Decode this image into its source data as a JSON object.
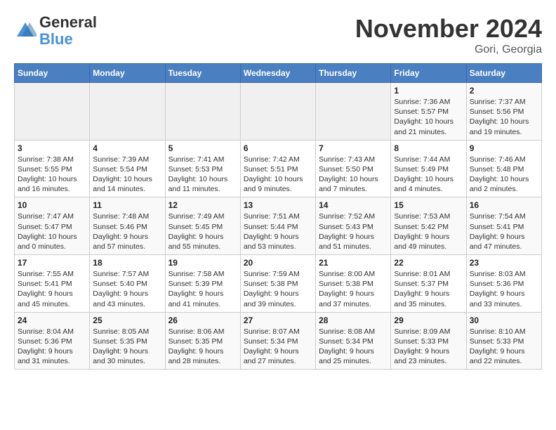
{
  "logo": {
    "general": "General",
    "blue": "Blue"
  },
  "title": "November 2024",
  "location": "Gori, Georgia",
  "days_of_week": [
    "Sunday",
    "Monday",
    "Tuesday",
    "Wednesday",
    "Thursday",
    "Friday",
    "Saturday"
  ],
  "weeks": [
    [
      {
        "day": "",
        "info": ""
      },
      {
        "day": "",
        "info": ""
      },
      {
        "day": "",
        "info": ""
      },
      {
        "day": "",
        "info": ""
      },
      {
        "day": "",
        "info": ""
      },
      {
        "day": "1",
        "info": "Sunrise: 7:36 AM\nSunset: 5:57 PM\nDaylight: 10 hours and 21 minutes."
      },
      {
        "day": "2",
        "info": "Sunrise: 7:37 AM\nSunset: 5:56 PM\nDaylight: 10 hours and 19 minutes."
      }
    ],
    [
      {
        "day": "3",
        "info": "Sunrise: 7:38 AM\nSunset: 5:55 PM\nDaylight: 10 hours and 16 minutes."
      },
      {
        "day": "4",
        "info": "Sunrise: 7:39 AM\nSunset: 5:54 PM\nDaylight: 10 hours and 14 minutes."
      },
      {
        "day": "5",
        "info": "Sunrise: 7:41 AM\nSunset: 5:53 PM\nDaylight: 10 hours and 11 minutes."
      },
      {
        "day": "6",
        "info": "Sunrise: 7:42 AM\nSunset: 5:51 PM\nDaylight: 10 hours and 9 minutes."
      },
      {
        "day": "7",
        "info": "Sunrise: 7:43 AM\nSunset: 5:50 PM\nDaylight: 10 hours and 7 minutes."
      },
      {
        "day": "8",
        "info": "Sunrise: 7:44 AM\nSunset: 5:49 PM\nDaylight: 10 hours and 4 minutes."
      },
      {
        "day": "9",
        "info": "Sunrise: 7:46 AM\nSunset: 5:48 PM\nDaylight: 10 hours and 2 minutes."
      }
    ],
    [
      {
        "day": "10",
        "info": "Sunrise: 7:47 AM\nSunset: 5:47 PM\nDaylight: 10 hours and 0 minutes."
      },
      {
        "day": "11",
        "info": "Sunrise: 7:48 AM\nSunset: 5:46 PM\nDaylight: 9 hours and 57 minutes."
      },
      {
        "day": "12",
        "info": "Sunrise: 7:49 AM\nSunset: 5:45 PM\nDaylight: 9 hours and 55 minutes."
      },
      {
        "day": "13",
        "info": "Sunrise: 7:51 AM\nSunset: 5:44 PM\nDaylight: 9 hours and 53 minutes."
      },
      {
        "day": "14",
        "info": "Sunrise: 7:52 AM\nSunset: 5:43 PM\nDaylight: 9 hours and 51 minutes."
      },
      {
        "day": "15",
        "info": "Sunrise: 7:53 AM\nSunset: 5:42 PM\nDaylight: 9 hours and 49 minutes."
      },
      {
        "day": "16",
        "info": "Sunrise: 7:54 AM\nSunset: 5:41 PM\nDaylight: 9 hours and 47 minutes."
      }
    ],
    [
      {
        "day": "17",
        "info": "Sunrise: 7:55 AM\nSunset: 5:41 PM\nDaylight: 9 hours and 45 minutes."
      },
      {
        "day": "18",
        "info": "Sunrise: 7:57 AM\nSunset: 5:40 PM\nDaylight: 9 hours and 43 minutes."
      },
      {
        "day": "19",
        "info": "Sunrise: 7:58 AM\nSunset: 5:39 PM\nDaylight: 9 hours and 41 minutes."
      },
      {
        "day": "20",
        "info": "Sunrise: 7:59 AM\nSunset: 5:38 PM\nDaylight: 9 hours and 39 minutes."
      },
      {
        "day": "21",
        "info": "Sunrise: 8:00 AM\nSunset: 5:38 PM\nDaylight: 9 hours and 37 minutes."
      },
      {
        "day": "22",
        "info": "Sunrise: 8:01 AM\nSunset: 5:37 PM\nDaylight: 9 hours and 35 minutes."
      },
      {
        "day": "23",
        "info": "Sunrise: 8:03 AM\nSunset: 5:36 PM\nDaylight: 9 hours and 33 minutes."
      }
    ],
    [
      {
        "day": "24",
        "info": "Sunrise: 8:04 AM\nSunset: 5:36 PM\nDaylight: 9 hours and 31 minutes."
      },
      {
        "day": "25",
        "info": "Sunrise: 8:05 AM\nSunset: 5:35 PM\nDaylight: 9 hours and 30 minutes."
      },
      {
        "day": "26",
        "info": "Sunrise: 8:06 AM\nSunset: 5:35 PM\nDaylight: 9 hours and 28 minutes."
      },
      {
        "day": "27",
        "info": "Sunrise: 8:07 AM\nSunset: 5:34 PM\nDaylight: 9 hours and 27 minutes."
      },
      {
        "day": "28",
        "info": "Sunrise: 8:08 AM\nSunset: 5:34 PM\nDaylight: 9 hours and 25 minutes."
      },
      {
        "day": "29",
        "info": "Sunrise: 8:09 AM\nSunset: 5:33 PM\nDaylight: 9 hours and 23 minutes."
      },
      {
        "day": "30",
        "info": "Sunrise: 8:10 AM\nSunset: 5:33 PM\nDaylight: 9 hours and 22 minutes."
      }
    ]
  ]
}
